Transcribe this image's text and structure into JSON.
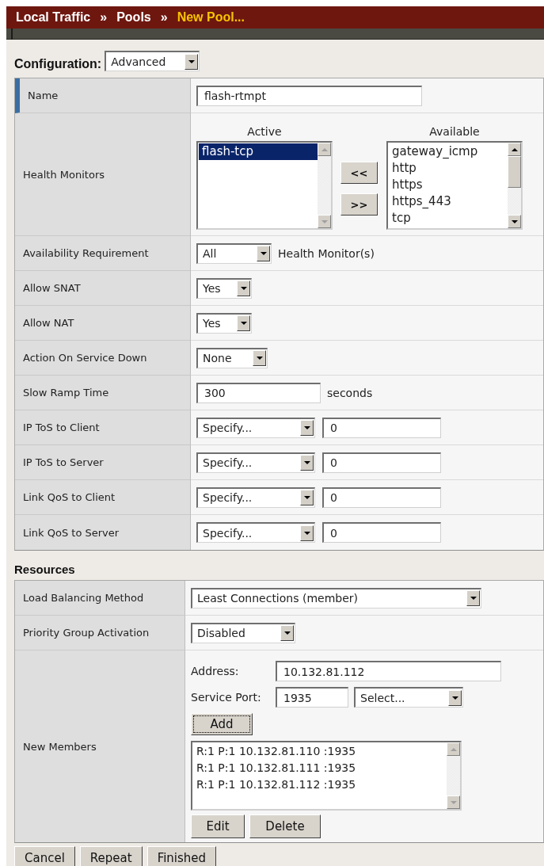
{
  "breadcrumb": [
    {
      "label": "Local Traffic",
      "current": false,
      "separator": "»"
    },
    {
      "label": "Pools",
      "current": false,
      "separator": "»"
    },
    {
      "label": "New Pool...",
      "current": true
    }
  ],
  "configuration": {
    "label": "Configuration:",
    "value": "Advanced"
  },
  "config_rows": [
    {
      "kind": "text",
      "label": "Name",
      "focused": true,
      "value": "flash-rtmpt"
    },
    {
      "kind": "dual_list",
      "label": "Health Monitors",
      "focused": false,
      "move_buttons": [
        "<<",
        ">>"
      ],
      "lists": [
        {
          "heading": "Active",
          "scrollable": false,
          "options": [
            {
              "label": "flash-tcp",
              "selected": true
            }
          ]
        },
        {
          "heading": "Available",
          "scrollable": true,
          "options": [
            {
              "label": "gateway_icmp",
              "selected": false
            },
            {
              "label": "http",
              "selected": false
            },
            {
              "label": "https",
              "selected": false
            },
            {
              "label": "https_443",
              "selected": false
            },
            {
              "label": "tcp",
              "selected": false
            }
          ]
        }
      ]
    },
    {
      "kind": "select",
      "label": "Availability Requirement",
      "focused": false,
      "value": "All",
      "suffix": "Health Monitor(s)"
    },
    {
      "kind": "select",
      "label": "Allow SNAT",
      "focused": false,
      "value": "Yes"
    },
    {
      "kind": "select",
      "label": "Allow NAT",
      "focused": false,
      "value": "Yes"
    },
    {
      "kind": "select",
      "label": "Action On Service Down",
      "focused": false,
      "value": "None"
    },
    {
      "kind": "text",
      "label": "Slow Ramp Time",
      "focused": false,
      "value": "300",
      "suffix": "seconds"
    },
    {
      "kind": "select_input",
      "label": "IP ToS to Client",
      "focused": false,
      "value": "Specify...",
      "input": "0"
    },
    {
      "kind": "select_input",
      "label": "IP ToS to Server",
      "focused": false,
      "value": "Specify...",
      "input": "0"
    },
    {
      "kind": "select_input",
      "label": "Link QoS to Client",
      "focused": false,
      "value": "Specify...",
      "input": "0"
    },
    {
      "kind": "select_input",
      "label": "Link QoS to Server",
      "focused": false,
      "value": "Specify...",
      "input": "0"
    }
  ],
  "resources": {
    "heading": "Resources",
    "rows": [
      {
        "kind": "select",
        "label": "Load Balancing Method",
        "value": "Least Connections (member)"
      },
      {
        "kind": "select",
        "label": "Priority Group Activation",
        "value": "Disabled"
      },
      {
        "kind": "members",
        "label": "New Members",
        "address_label": "Address:",
        "address": "10.132.81.112",
        "port_label": "Service Port:",
        "port": "1935",
        "port_select": "Select...",
        "add_button": "Add",
        "members": [
          {
            "label": "R:1 P:1 10.132.81.110 :1935",
            "selected": false
          },
          {
            "label": "R:1 P:1 10.132.81.111 :1935",
            "selected": false
          },
          {
            "label": "R:1 P:1 10.132.81.112 :1935",
            "selected": false
          }
        ],
        "buttons": [
          "Edit",
          "Delete"
        ]
      }
    ]
  },
  "footer_buttons": [
    "Cancel",
    "Repeat",
    "Finished"
  ]
}
